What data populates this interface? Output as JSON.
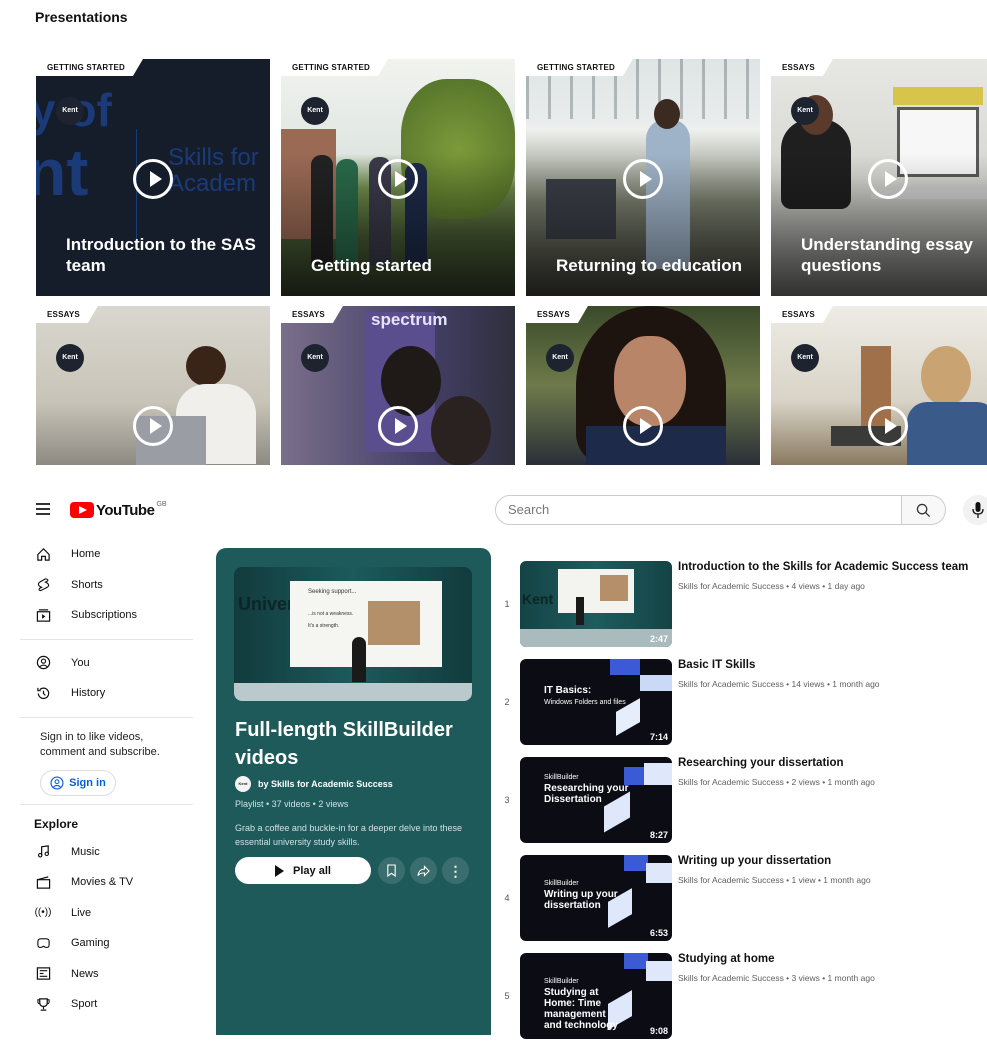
{
  "presentations": {
    "title": "Presentations",
    "cards": [
      {
        "tag": "GETTING STARTED",
        "caption": "Introduction to the SAS team",
        "logo": "Kent"
      },
      {
        "tag": "GETTING STARTED",
        "caption": "Getting started",
        "logo": "Kent"
      },
      {
        "tag": "GETTING STARTED",
        "caption": "Returning to education",
        "logo": "Kent"
      },
      {
        "tag": "ESSAYS",
        "caption": "Understanding essay questions",
        "logo": "Kent"
      },
      {
        "tag": "ESSAYS",
        "caption": "",
        "logo": "Kent"
      },
      {
        "tag": "ESSAYS",
        "caption": "",
        "logo": "Kent"
      },
      {
        "tag": "ESSAYS",
        "caption": "",
        "logo": "Kent"
      },
      {
        "tag": "ESSAYS",
        "caption": "",
        "logo": "Kent"
      }
    ],
    "card1_bg_text_a": "y of",
    "card1_bg_text_b": "nt",
    "card1_bg_text_c": "Skills for",
    "card1_bg_text_d": "Academ",
    "card6_sign": "spectrum"
  },
  "youtube": {
    "logo_text": "YouTube",
    "region": "GB",
    "search_placeholder": "Search",
    "sidebar": {
      "top": [
        {
          "label": "Home",
          "icon": "home-icon"
        },
        {
          "label": "Shorts",
          "icon": "shorts-icon"
        },
        {
          "label": "Subscriptions",
          "icon": "subscriptions-icon"
        }
      ],
      "you": [
        {
          "label": "You",
          "icon": "you-icon"
        },
        {
          "label": "History",
          "icon": "history-icon"
        }
      ],
      "signin_text": "Sign in to like videos, comment and subscribe.",
      "signin_label": "Sign in",
      "explore_title": "Explore",
      "explore": [
        {
          "label": "Music",
          "icon": "music-icon"
        },
        {
          "label": "Movies & TV",
          "icon": "movies-icon"
        },
        {
          "label": "Live",
          "icon": "live-icon"
        },
        {
          "label": "Gaming",
          "icon": "gaming-icon"
        },
        {
          "label": "News",
          "icon": "news-icon"
        },
        {
          "label": "Sport",
          "icon": "sport-icon"
        }
      ]
    },
    "playlist": {
      "title": "Full-length SkillBuilder videos",
      "owner": "by Skills for Academic Success",
      "meta": "Playlist • 37 videos • 2 views",
      "description": "Grab a coffee and buckle-in for a deeper delve into these essential university study skills.",
      "play_all": "Play all",
      "thumb_slide_line1": "Seeking support...",
      "thumb_slide_line2": "...is not a weakness.",
      "thumb_slide_line3": "It's a strength.",
      "thumb_brand": "University of Kent"
    },
    "videos": [
      {
        "index": "1",
        "title": "Introduction to the Skills for Academic Success team",
        "meta": "Skills for Academic Success • 4 views • 1 day ago",
        "duration": "2:47",
        "thumb_text": ""
      },
      {
        "index": "2",
        "title": "Basic IT Skills",
        "meta": "Skills for Academic Success • 14 views • 1 month ago",
        "duration": "7:14",
        "thumb_text": "IT Basics:",
        "thumb_sub": "Windows Folders and files"
      },
      {
        "index": "3",
        "title": "Researching your dissertation",
        "meta": "Skills for Academic Success • 2 views • 1 month ago",
        "duration": "8:27",
        "thumb_text": "Researching your Dissertation",
        "thumb_sub": "SkillBuilder"
      },
      {
        "index": "4",
        "title": "Writing up your dissertation",
        "meta": "Skills for Academic Success • 1 view • 1 month ago",
        "duration": "6:53",
        "thumb_text": "Writing up your dissertation",
        "thumb_sub": "SkillBuilder"
      },
      {
        "index": "5",
        "title": "Studying at home",
        "meta": "Skills for Academic Success • 3 views • 1 month ago",
        "duration": "9:08",
        "thumb_text": "Studying at Home: Time management and technology",
        "thumb_sub": "SkillBuilder"
      }
    ]
  }
}
